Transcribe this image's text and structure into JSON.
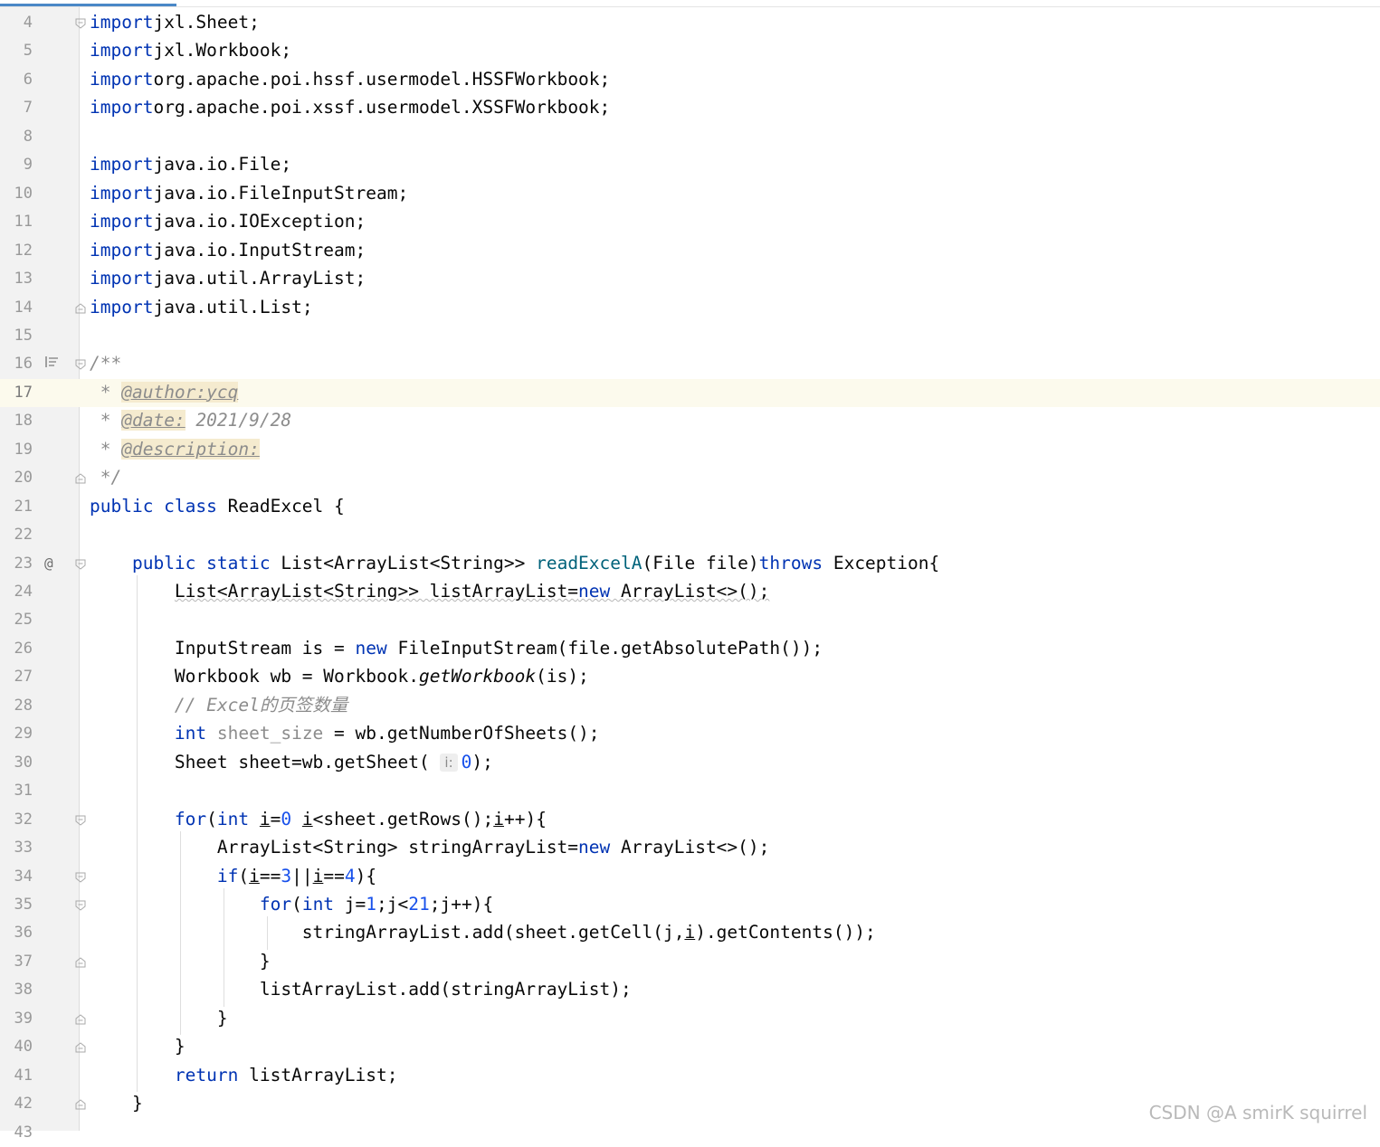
{
  "editor": {
    "lines": [
      {
        "n": "4",
        "t": [
          [
            "kw",
            "import"
          ],
          [
            "",
            "jxl.Sheet;"
          ]
        ]
      },
      {
        "n": "5",
        "t": [
          [
            "kw",
            "import"
          ],
          [
            "",
            "jxl.Workbook;"
          ]
        ]
      },
      {
        "n": "6",
        "t": [
          [
            "kw",
            "import"
          ],
          [
            "",
            "org.apache.poi.hssf.usermodel.HSSFWorkbook;"
          ]
        ]
      },
      {
        "n": "7",
        "t": [
          [
            "kw",
            "import"
          ],
          [
            "",
            "org.apache.poi.xssf.usermodel.XSSFWorkbook;"
          ]
        ]
      },
      {
        "n": "8",
        "t": []
      },
      {
        "n": "9",
        "t": [
          [
            "kw",
            "import"
          ],
          [
            "",
            "java.io.File;"
          ]
        ]
      },
      {
        "n": "10",
        "t": [
          [
            "kw",
            "import"
          ],
          [
            "",
            "java.io.FileInputStream;"
          ]
        ]
      },
      {
        "n": "11",
        "t": [
          [
            "kw",
            "import"
          ],
          [
            "",
            "java.io.IOException;"
          ]
        ]
      },
      {
        "n": "12",
        "t": [
          [
            "kw",
            "import"
          ],
          [
            "",
            "java.io.InputStream;"
          ]
        ]
      },
      {
        "n": "13",
        "t": [
          [
            "kw",
            "import"
          ],
          [
            "",
            "java.util.ArrayList;"
          ]
        ]
      },
      {
        "n": "14",
        "t": [
          [
            "kw",
            "import"
          ],
          [
            "",
            "java.util.List;"
          ]
        ]
      },
      {
        "n": "15",
        "t": []
      },
      {
        "n": "16",
        "t": [
          [
            "cm",
            "/**"
          ]
        ]
      },
      {
        "n": "17",
        "t": [
          [
            "cm",
            " * "
          ],
          [
            "tag",
            "@author:ycq"
          ]
        ]
      },
      {
        "n": "18",
        "t": [
          [
            "cm",
            " * "
          ],
          [
            "tag",
            "@date:"
          ],
          [
            "cm",
            " 2021/9/28"
          ]
        ]
      },
      {
        "n": "19",
        "t": [
          [
            "cm",
            " * "
          ],
          [
            "tag",
            "@description:"
          ]
        ]
      },
      {
        "n": "20",
        "t": [
          [
            "cm",
            " */"
          ]
        ]
      },
      {
        "n": "21",
        "t": [
          [
            "kw",
            "public class"
          ],
          [
            "",
            " ReadExcel {"
          ]
        ]
      },
      {
        "n": "22",
        "t": []
      },
      {
        "n": "23",
        "t": [
          [
            "",
            "    "
          ],
          [
            "kw",
            "public static"
          ],
          [
            "",
            " List<ArrayList<String>> "
          ],
          [
            "fn",
            "readExcelA"
          ],
          [
            "",
            "(File file)"
          ],
          [
            "kw",
            "throws"
          ],
          [
            "",
            " Exception{"
          ]
        ]
      },
      {
        "n": "24",
        "t": [
          [
            "",
            "        "
          ],
          [
            "squig",
            "List<ArrayList<String>> listArrayList="
          ],
          [
            "kw squig",
            "new"
          ],
          [
            "squig",
            " ArrayList<>();"
          ]
        ]
      },
      {
        "n": "25",
        "t": []
      },
      {
        "n": "26",
        "t": [
          [
            "",
            "        InputStream is = "
          ],
          [
            "kw",
            "new"
          ],
          [
            "",
            " FileInputStream(file.getAbsolutePath());"
          ]
        ]
      },
      {
        "n": "27",
        "t": [
          [
            "",
            "        Workbook wb = Workbook."
          ],
          [
            "em",
            "getWorkbook"
          ],
          [
            "",
            "(is);"
          ]
        ]
      },
      {
        "n": "28",
        "t": [
          [
            "",
            "        "
          ],
          [
            "cm",
            "// Excel的页签数量"
          ]
        ]
      },
      {
        "n": "29",
        "t": [
          [
            "",
            "        "
          ],
          [
            "kw",
            "int"
          ],
          [
            "cm-plain",
            " sheet_size"
          ],
          [
            "",
            " = wb.getNumberOfSheets();"
          ]
        ]
      },
      {
        "n": "30",
        "t": [
          [
            "",
            "        Sheet sheet=wb.getSheet( "
          ],
          [
            "hint",
            "i:"
          ],
          [
            "num",
            "0"
          ],
          [
            "",
            ");"
          ]
        ]
      },
      {
        "n": "31",
        "t": []
      },
      {
        "n": "32",
        "t": [
          [
            "",
            "        "
          ],
          [
            "kw",
            "for"
          ],
          [
            "",
            "("
          ],
          [
            "kw",
            "int"
          ],
          [
            "",
            " "
          ],
          [
            "ul",
            "i"
          ],
          [
            "",
            "="
          ],
          [
            "num",
            "0"
          ],
          [
            ";",
            " "
          ],
          [
            "ul",
            "i"
          ],
          [
            "",
            "<sheet.getRows();"
          ],
          [
            "ul",
            "i"
          ],
          [
            "",
            "++){"
          ]
        ]
      },
      {
        "n": "33",
        "t": [
          [
            "",
            "            ArrayList<String> stringArrayList="
          ],
          [
            "kw",
            "new"
          ],
          [
            "",
            " ArrayList<>();"
          ]
        ]
      },
      {
        "n": "34",
        "t": [
          [
            "",
            "            "
          ],
          [
            "kw",
            "if"
          ],
          [
            "",
            "("
          ],
          [
            "ul",
            "i"
          ],
          [
            "",
            "=="
          ],
          [
            "num",
            "3"
          ],
          [
            "",
            "||"
          ],
          [
            "ul",
            "i"
          ],
          [
            "",
            "=="
          ],
          [
            "num",
            "4"
          ],
          [
            "",
            "){"
          ]
        ]
      },
      {
        "n": "35",
        "t": [
          [
            "",
            "                "
          ],
          [
            "kw",
            "for"
          ],
          [
            "",
            "("
          ],
          [
            "kw",
            "int"
          ],
          [
            "",
            " j="
          ],
          [
            "num",
            "1"
          ],
          [
            "",
            ";j<"
          ],
          [
            "num",
            "21"
          ],
          [
            "",
            ";j++){"
          ]
        ]
      },
      {
        "n": "36",
        "t": [
          [
            "",
            "                    stringArrayList.add(sheet.getCell(j,"
          ],
          [
            "ul",
            "i"
          ],
          [
            "",
            ").getContents());"
          ]
        ]
      },
      {
        "n": "37",
        "t": [
          [
            "",
            "                }"
          ]
        ]
      },
      {
        "n": "38",
        "t": [
          [
            "",
            "                listArrayList.add(stringArrayList);"
          ]
        ]
      },
      {
        "n": "39",
        "t": [
          [
            "",
            "            }"
          ]
        ]
      },
      {
        "n": "40",
        "t": [
          [
            "",
            "        }"
          ]
        ]
      },
      {
        "n": "41",
        "t": [
          [
            "",
            "        "
          ],
          [
            "kw",
            "return"
          ],
          [
            "",
            " listArrayList;"
          ]
        ]
      },
      {
        "n": "42",
        "t": [
          [
            "",
            "    }"
          ]
        ]
      },
      {
        "n": "43",
        "t": []
      }
    ],
    "caret_line": "17"
  },
  "watermark": "CSDN @A smirK squirrel",
  "colors": {
    "keyword": "#0033b3",
    "number": "#1750eb",
    "method": "#00627a",
    "comment": "#8c8c8c",
    "tag_bg": "#f5ebcf",
    "caret_row": "#fcfaed",
    "gutter": "#f2f2f2"
  }
}
